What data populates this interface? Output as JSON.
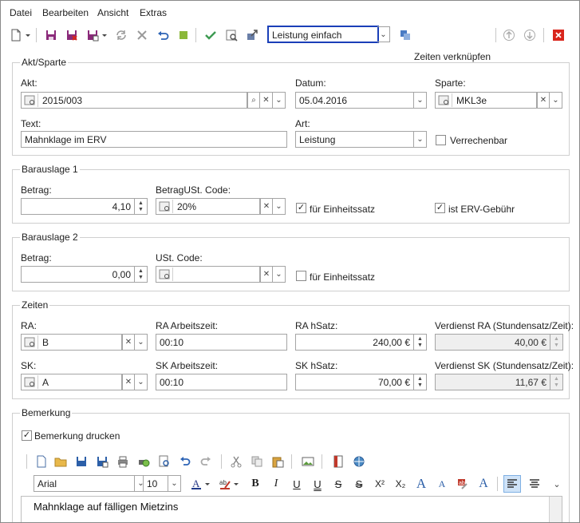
{
  "menu": {
    "items": [
      "Datei",
      "Bearbeiten",
      "Ansicht",
      "Extras"
    ]
  },
  "toolbar": {
    "mode_value": "Leistung einfach",
    "link_label": "Zeiten verknüpfen"
  },
  "akt": {
    "title": "Akt/Sparte",
    "akt_label": "Akt:",
    "akt_value": "2015/003",
    "datum_label": "Datum:",
    "datum_value": "05.04.2016",
    "sparte_label": "Sparte:",
    "sparte_value": "MKL3e",
    "text_label": "Text:",
    "text_value": "Mahnklage im ERV",
    "art_label": "Art:",
    "art_value": "Leistung",
    "verrechenbar_label": "Verrechenbar",
    "verrechenbar_checked": false
  },
  "b1": {
    "title": "Barauslage 1",
    "betrag_label": "Betrag:",
    "betrag_value": "4,10",
    "ust_label": "BetragUSt. Code:",
    "ust_value": "20%",
    "einheit_label": "für Einheitssatz",
    "einheit_checked": true,
    "erv_label": "ist ERV-Gebühr",
    "erv_checked": true
  },
  "b2": {
    "title": "Barauslage 2",
    "betrag_label": "Betrag:",
    "betrag_value": "0,00",
    "ust_label": "USt. Code:",
    "ust_value": "",
    "einheit_label": "für Einheitssatz",
    "einheit_checked": false
  },
  "zeiten": {
    "title": "Zeiten",
    "ra_label": "RA:",
    "ra_value": "B",
    "ra_zeit_label": "RA Arbeitszeit:",
    "ra_zeit_value": "00:10",
    "ra_satz_label": "RA hSatz:",
    "ra_satz_value": "240,00 €",
    "ra_verd_label": "Verdienst RA (Stundensatz/Zeit):",
    "ra_verd_value": "40,00 €",
    "sk_label": "SK:",
    "sk_value": "A",
    "sk_zeit_label": "SK Arbeitszeit:",
    "sk_zeit_value": "00:10",
    "sk_satz_label": "SK hSatz:",
    "sk_satz_value": "70,00 €",
    "sk_verd_label": "Verdienst SK (Stundensatz/Zeit):",
    "sk_verd_value": "11,67 €"
  },
  "bem": {
    "title": "Bemerkung",
    "drucken_label": "Bemerkung drucken",
    "drucken_checked": true,
    "font": "Arial",
    "size": "10",
    "text": "Mahnklage auf fälligen Mietzins"
  },
  "colors": {
    "accent": "#1a3fb8",
    "close_red": "#d9261c",
    "group_border": "#cfcfcf"
  }
}
